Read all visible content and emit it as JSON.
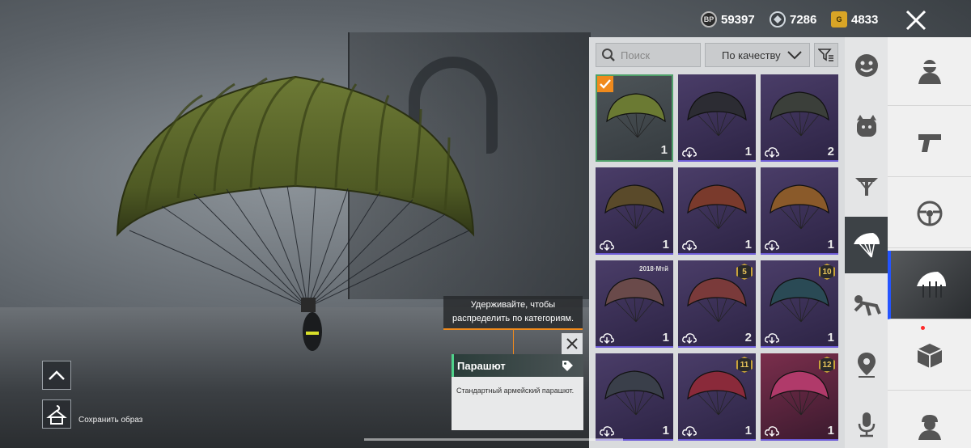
{
  "currency": {
    "bp": {
      "icon": "BP",
      "value": "59397"
    },
    "silver": {
      "icon": "silver-coin",
      "value": "7286"
    },
    "gold": {
      "icon": "G",
      "value": "4833"
    }
  },
  "inventory": {
    "search_placeholder": "Поиск",
    "sort_label": "По качеству",
    "items": [
      {
        "qty": "1",
        "selected": true,
        "level": "",
        "color": "#6b7a33"
      },
      {
        "qty": "1",
        "level": "",
        "color": "#2c2c33"
      },
      {
        "qty": "2",
        "level": "",
        "color": "#3b3f3a"
      },
      {
        "qty": "1",
        "level": "",
        "color": "#5a4a2a"
      },
      {
        "qty": "1",
        "level": "",
        "color": "#7a3a2c"
      },
      {
        "qty": "1",
        "level": "",
        "color": "#8a5a2a"
      },
      {
        "qty": "1",
        "level": "",
        "tag": "2018·Мтй",
        "color": "#6a4a4a"
      },
      {
        "qty": "2",
        "level": "5",
        "color": "#7a3a3a"
      },
      {
        "qty": "1",
        "level": "10",
        "color": "#2a4a55"
      },
      {
        "qty": "1",
        "level": "",
        "color": "#3a3f4a"
      },
      {
        "qty": "1",
        "level": "11",
        "color": "#8a2a3a"
      },
      {
        "qty": "1",
        "level": "12",
        "color": "#b03a6a"
      }
    ]
  },
  "tooltip": {
    "text": "Удерживайте, чтобы распределить по категориям."
  },
  "item_info": {
    "name": "Парашют",
    "description": "Стандартный армейский парашют."
  },
  "controls": {
    "save_outfit_label": "Сохранить образ"
  }
}
